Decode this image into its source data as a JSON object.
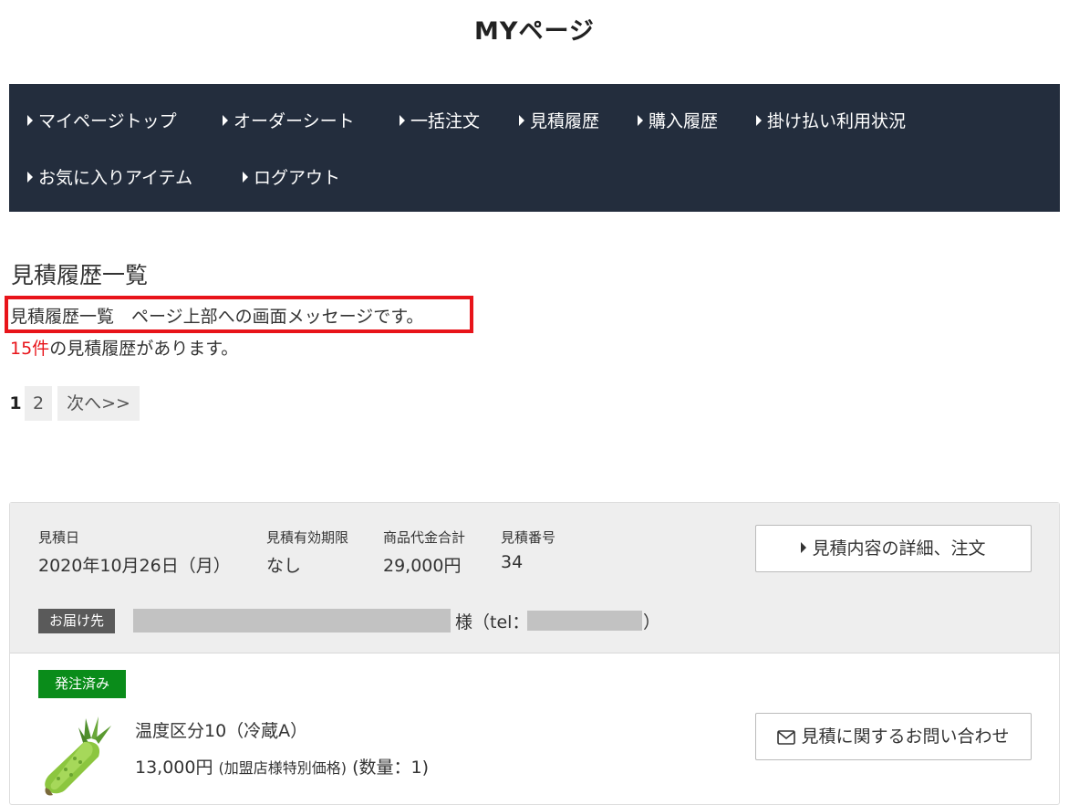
{
  "page": {
    "title": "MYページ"
  },
  "nav": {
    "items": [
      "マイページトップ",
      "オーダーシート",
      "一括注文",
      "見積履歴",
      "購入履歴",
      "掛け払い利用状況",
      "お気に入りアイテム",
      "ログアウト"
    ]
  },
  "section": {
    "title": "見積履歴一覧",
    "message": "見積履歴一覧　ページ上部への画面メッセージです。",
    "count_num": "15件",
    "count_suffix": "の見積履歴があります。"
  },
  "pager": {
    "current": "1",
    "page2": "2",
    "next": "次へ>>"
  },
  "quote": {
    "date_label": "見積日",
    "date_value": "2020年10月26日（月）",
    "expiry_label": "見積有効期限",
    "expiry_value": "なし",
    "total_label": "商品代金合計",
    "total_value": "29,000円",
    "number_label": "見積番号",
    "number_value": "34",
    "detail_button": "見積内容の詳細、注文",
    "delivery_badge": "お届け先",
    "delivery_suffix": "様（tel：",
    "delivery_close": "）",
    "status_badge": "発注済み",
    "item_name": "温度区分10（冷蔵A）",
    "item_price": "13,000円",
    "item_price_note": "(加盟店様特別価格)",
    "item_qty": "(数量：1)",
    "inquiry_button": "見積に関するお問い合わせ"
  },
  "colors": {
    "nav_bg": "#232d3d",
    "highlight_border": "#e8141a",
    "count_red": "#e8141a",
    "status_green": "#0a8c1a",
    "badge_dark": "#5a5a5a"
  },
  "icons": {
    "nav_bullet": "triangle-right-icon",
    "inquiry": "envelope-icon",
    "product": "wasabi-image"
  }
}
